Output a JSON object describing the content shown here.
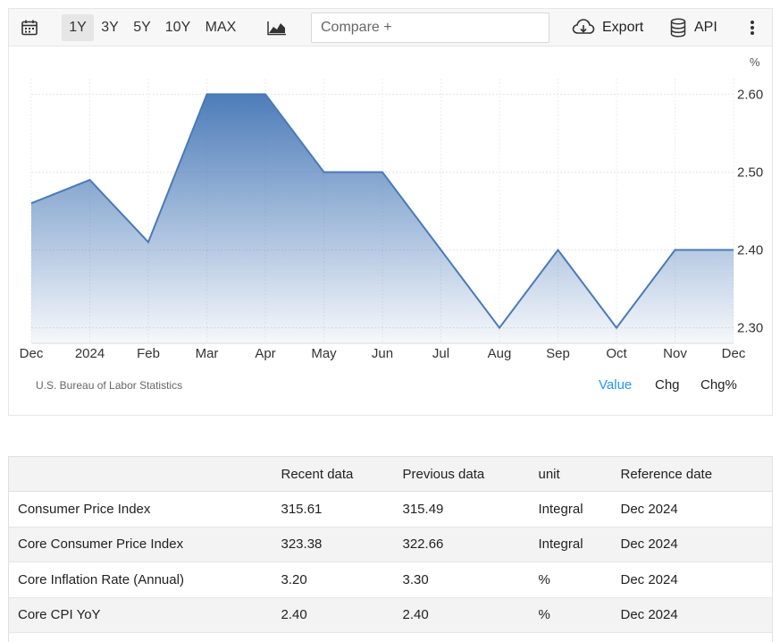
{
  "toolbar": {
    "ranges": [
      "1Y",
      "3Y",
      "5Y",
      "10Y",
      "MAX"
    ],
    "active_range": "1Y",
    "compare_placeholder": "Compare +",
    "export_label": "Export",
    "api_label": "API",
    "icons": {
      "calendar": "calendar-icon",
      "chart_type": "area-chart-icon",
      "export": "cloud-download-icon",
      "api": "database-icon",
      "more": "more-vertical-icon"
    }
  },
  "chart": {
    "unit": "%",
    "source": "U.S. Bureau of Labor Statistics",
    "views": [
      "Value",
      "Chg",
      "Chg%"
    ],
    "active_view": "Value",
    "line_color": "#4a7ab8"
  },
  "chart_data": {
    "type": "area",
    "x": [
      "Dec",
      "2024",
      "Feb",
      "Mar",
      "Apr",
      "May",
      "Jun",
      "Jul",
      "Aug",
      "Sep",
      "Oct",
      "Nov",
      "Dec"
    ],
    "values": [
      2.46,
      2.49,
      2.41,
      2.6,
      2.6,
      2.5,
      2.5,
      2.4,
      2.3,
      2.4,
      2.3,
      2.4,
      2.4
    ],
    "yticks": [
      "2.60",
      "2.50",
      "2.40",
      "2.30"
    ],
    "ylim": [
      2.28,
      2.62
    ],
    "grid": true
  },
  "table": {
    "headers": [
      "",
      "Recent data",
      "Previous data",
      "unit",
      "Reference date"
    ],
    "rows": [
      [
        "Consumer Price Index",
        "315.61",
        "315.49",
        "Integral",
        "Dec 2024"
      ],
      [
        "Core Consumer Price Index",
        "323.38",
        "322.66",
        "Integral",
        "Dec 2024"
      ],
      [
        "Core Inflation Rate (Annual)",
        "3.20",
        "3.30",
        "%",
        "Dec 2024"
      ],
      [
        "Core CPI YoY",
        "2.40",
        "2.40",
        "%",
        "Dec 2024"
      ]
    ]
  }
}
